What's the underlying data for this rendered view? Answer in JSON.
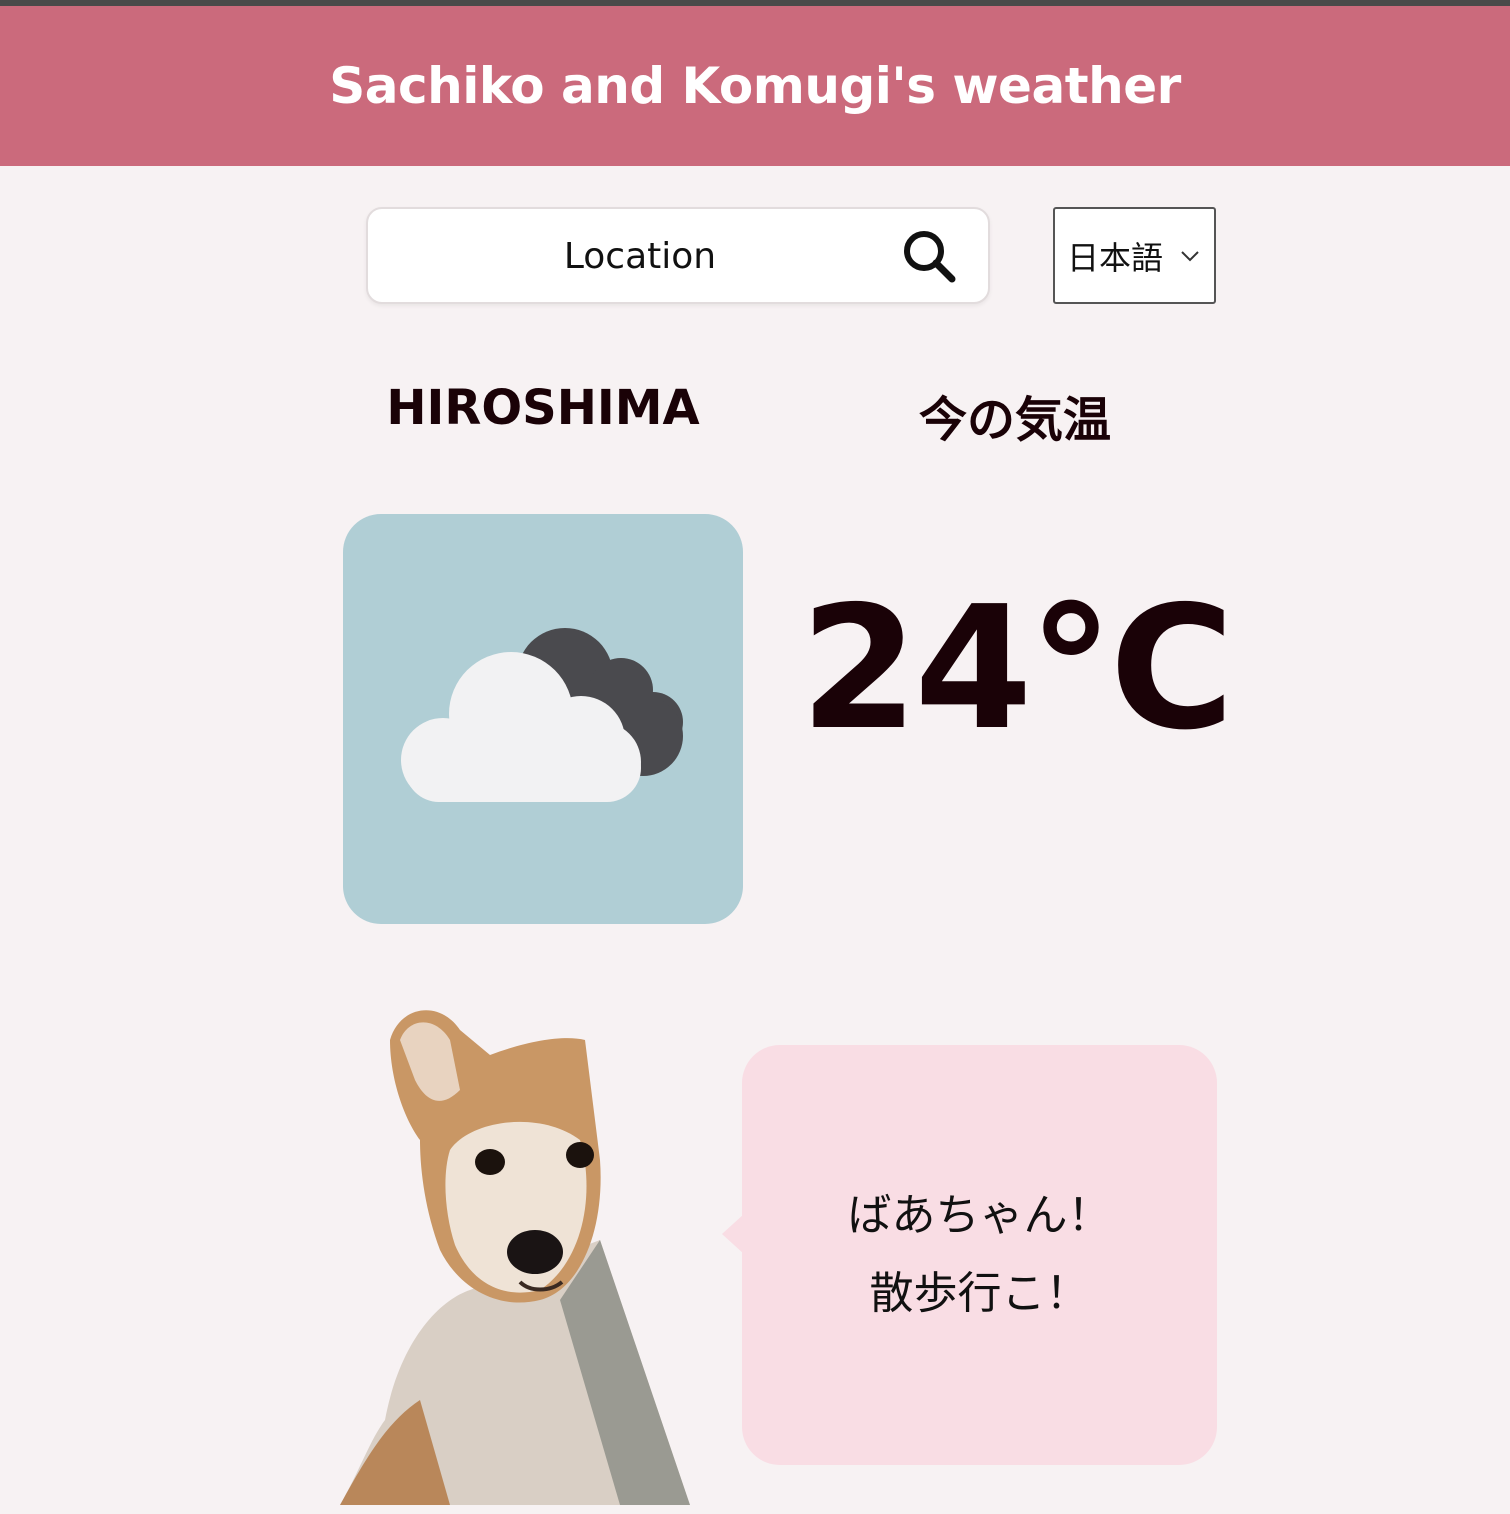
{
  "header": {
    "title": "Sachiko and Komugi's weather"
  },
  "search": {
    "placeholder": "Location",
    "icon": "search-icon"
  },
  "language": {
    "selected": "日本語",
    "icon": "chevron-down-icon"
  },
  "weather": {
    "city": "HIROSHIMA",
    "temp_label": "今の気温",
    "temperature": "24℃",
    "condition_icon": "cloudy-icon"
  },
  "bubble": {
    "line1": "ばあちゃん！",
    "line2": "散歩行こ！"
  },
  "colors": {
    "header_bg": "#cb6a7c",
    "page_bg": "#f7f2f3",
    "weather_box_bg": "#b0ced5",
    "bubble_bg": "#f9dde4",
    "text_dark": "#1a0207"
  }
}
